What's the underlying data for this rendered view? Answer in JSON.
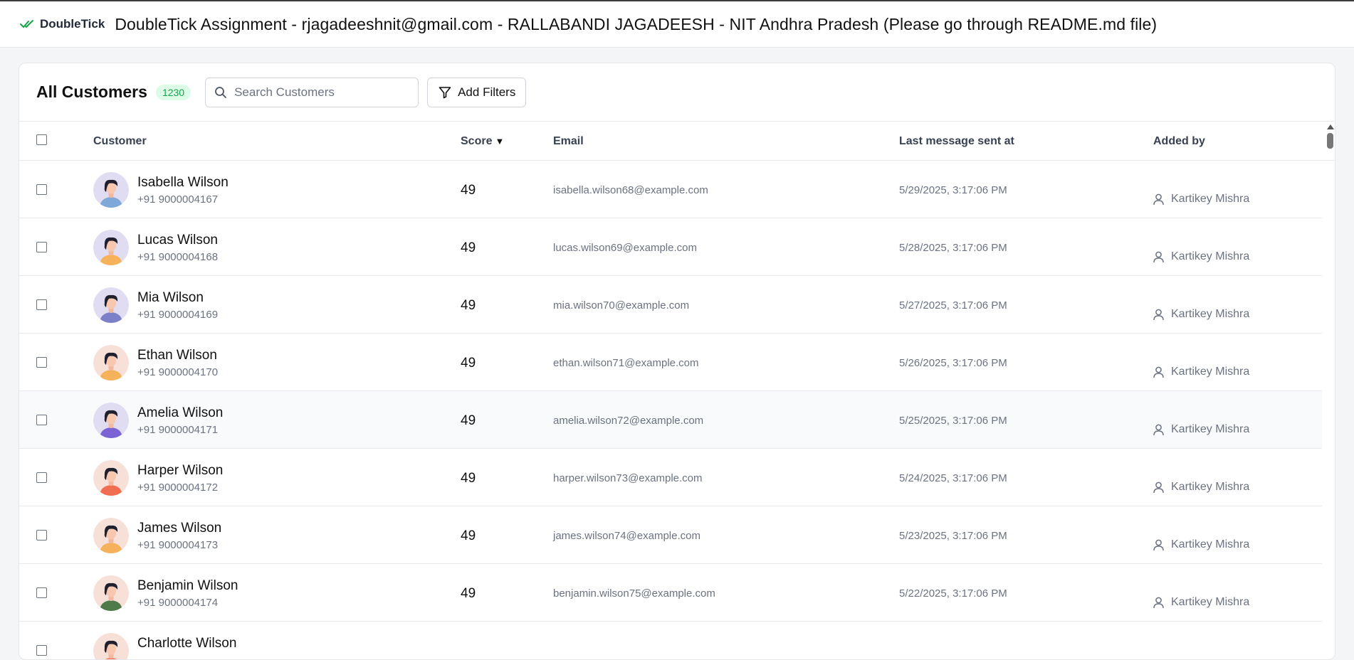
{
  "app": {
    "logo_text": "DoubleTick",
    "title": "DoubleTick Assignment - rjagadeeshnit@gmail.com - RALLABANDI JAGADEESH - NIT Andhra Pradesh (Please go through README.md file)"
  },
  "header": {
    "title": "All Customers",
    "count": "1230",
    "search_placeholder": "Search Customers",
    "filter_label": "Add Filters"
  },
  "columns": {
    "customer": "Customer",
    "score": "Score",
    "email": "Email",
    "last_message": "Last message sent at",
    "added_by": "Added by"
  },
  "colors": {
    "brand_green": "#16a34a",
    "badge_bg": "#dcfce7"
  },
  "rows": [
    {
      "name": "Isabella Wilson",
      "phone": "+91 9000004167",
      "score": "49",
      "email": "isabella.wilson68@example.com",
      "date": "5/29/2025, 3:17:06 PM",
      "added_by": "Kartikey Mishra",
      "avatar_bg": "#e0dcf2",
      "shirt": "#7fa7d8",
      "hair": "#1f1f2e"
    },
    {
      "name": "Lucas Wilson",
      "phone": "+91 9000004168",
      "score": "49",
      "email": "lucas.wilson69@example.com",
      "date": "5/28/2025, 3:17:06 PM",
      "added_by": "Kartikey Mishra",
      "avatar_bg": "#e0dcf2",
      "shirt": "#f6b25a",
      "hair": "#1f1f2e"
    },
    {
      "name": "Mia Wilson",
      "phone": "+91 9000004169",
      "score": "49",
      "email": "mia.wilson70@example.com",
      "date": "5/27/2025, 3:17:06 PM",
      "added_by": "Kartikey Mishra",
      "avatar_bg": "#e0dcf2",
      "shirt": "#7b80c9",
      "hair": "#1f1f2e"
    },
    {
      "name": "Ethan Wilson",
      "phone": "+91 9000004170",
      "score": "49",
      "email": "ethan.wilson71@example.com",
      "date": "5/26/2025, 3:17:06 PM",
      "added_by": "Kartikey Mishra",
      "avatar_bg": "#f7e0d8",
      "shirt": "#f6b25a",
      "hair": "#1f1f2e"
    },
    {
      "name": "Amelia Wilson",
      "phone": "+91 9000004171",
      "score": "49",
      "email": "amelia.wilson72@example.com",
      "date": "5/25/2025, 3:17:06 PM",
      "added_by": "Kartikey Mishra",
      "avatar_bg": "#e0dcf2",
      "shirt": "#7b63d6",
      "hair": "#1f1f2e"
    },
    {
      "name": "Harper Wilson",
      "phone": "+91 9000004172",
      "score": "49",
      "email": "harper.wilson73@example.com",
      "date": "5/24/2025, 3:17:06 PM",
      "added_by": "Kartikey Mishra",
      "avatar_bg": "#f7e0d8",
      "shirt": "#f06d4f",
      "hair": "#1f1f2e"
    },
    {
      "name": "James Wilson",
      "phone": "+91 9000004173",
      "score": "49",
      "email": "james.wilson74@example.com",
      "date": "5/23/2025, 3:17:06 PM",
      "added_by": "Kartikey Mishra",
      "avatar_bg": "#f7e0d8",
      "shirt": "#f6b25a",
      "hair": "#1f1f2e"
    },
    {
      "name": "Benjamin Wilson",
      "phone": "+91 9000004174",
      "score": "49",
      "email": "benjamin.wilson75@example.com",
      "date": "5/22/2025, 3:17:06 PM",
      "added_by": "Kartikey Mishra",
      "avatar_bg": "#f7e0d8",
      "shirt": "#4f7a4a",
      "hair": "#1f1f2e"
    },
    {
      "name": "Charlotte Wilson",
      "phone": "",
      "score": "",
      "email": "",
      "date": "",
      "added_by": "",
      "avatar_bg": "#f7e0d8",
      "shirt": "#f06d4f",
      "hair": "#1f1f2e"
    }
  ],
  "icons": {
    "logo": "double-check-icon",
    "search": "search-icon",
    "filter": "filter-icon",
    "user": "user-icon",
    "sort": "sort-down-icon"
  }
}
